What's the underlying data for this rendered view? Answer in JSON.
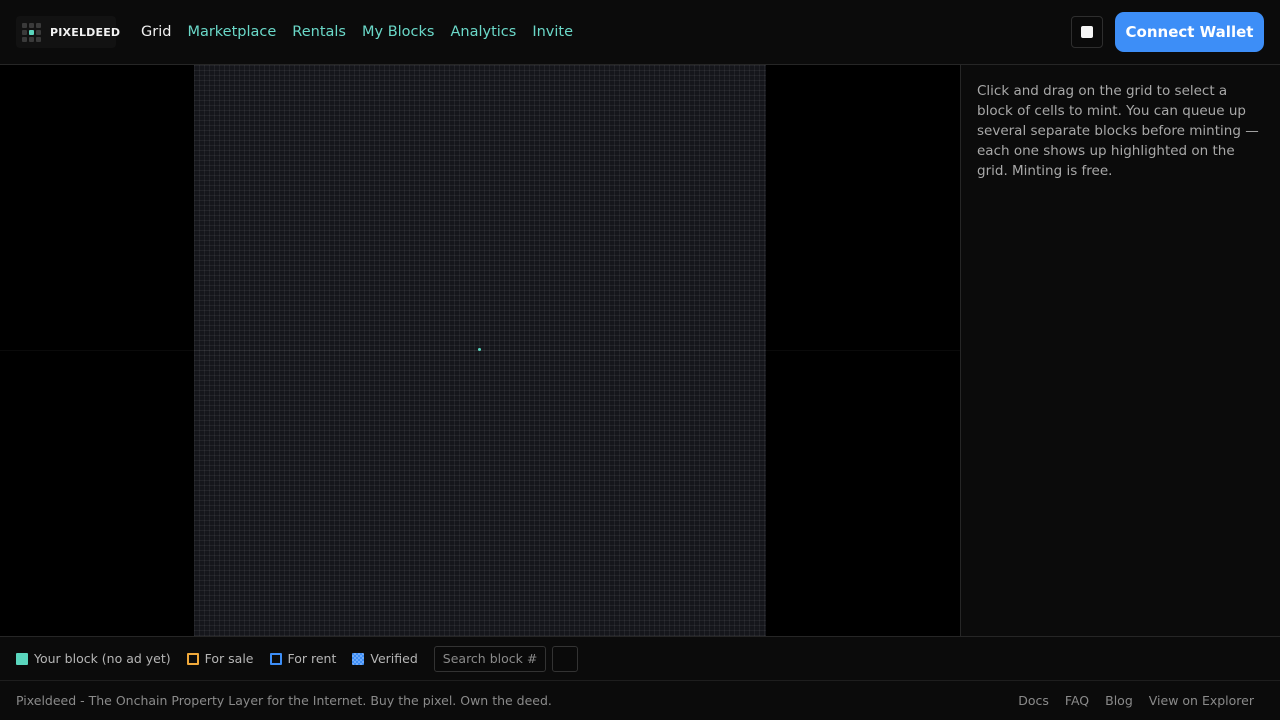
{
  "brand": {
    "name": "PIXELDEED",
    "accent_color": "#5ad6bd"
  },
  "nav": {
    "items": [
      {
        "label": "Grid",
        "active": true
      },
      {
        "label": "Marketplace",
        "active": false
      },
      {
        "label": "Rentals",
        "active": false
      },
      {
        "label": "My Blocks",
        "active": false
      },
      {
        "label": "Analytics",
        "active": false
      },
      {
        "label": "Invite",
        "active": false
      }
    ]
  },
  "header": {
    "theme_toggle_icon": "theme-toggle-icon",
    "connect_wallet_label": "Connect Wallet",
    "connect_wallet_color": "#3d8ef7"
  },
  "side_panel": {
    "help_text": "Click and drag on the grid to select a block of cells to mint. You can queue up several separate blocks before minting — each one shows up highlighted on the grid. Minting is free."
  },
  "legend": {
    "items": [
      {
        "label": "Your block (no ad yet)",
        "color": "#5ad6bd"
      },
      {
        "label": "For sale",
        "color": "#f0a93b"
      },
      {
        "label": "For rent",
        "color": "#3d8ef7"
      },
      {
        "label": "Verified",
        "color": "#3d8ef7"
      }
    ],
    "search_placeholder": "Search block #"
  },
  "footer": {
    "tagline": "Pixeldeed - The Onchain Property Layer for the Internet. Buy the pixel. Own the deed.",
    "links": [
      "Docs",
      "FAQ",
      "Blog",
      "View on Explorer"
    ]
  }
}
